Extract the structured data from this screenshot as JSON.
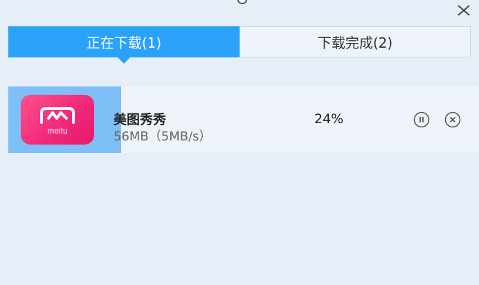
{
  "window": {
    "close_icon": "close-icon",
    "top_icon": "pin-icon"
  },
  "tabs": [
    {
      "label": "正在下载(1)",
      "active": true
    },
    {
      "label": "下载完成(2)",
      "active": false
    }
  ],
  "downloads": [
    {
      "name": "美图秀秀",
      "size_speed": "56MB（5MB/s）",
      "progress_text": "24%",
      "progress": 0.24,
      "icon": "meitu-app-icon",
      "icon_text": "meitu",
      "actions": [
        "pause-icon",
        "cancel-icon"
      ]
    }
  ],
  "colors": {
    "accent": "#2aa2f8",
    "progress_fill": "#7dbff6",
    "background": "#e6eef7",
    "icon_gradient": "#f0287a"
  }
}
